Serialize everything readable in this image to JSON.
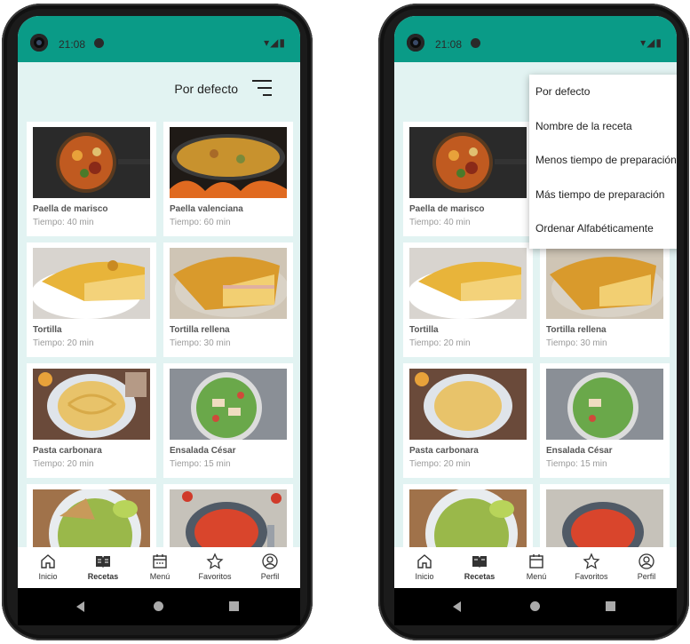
{
  "status": {
    "time": "21:08",
    "right_icons": "▾◢▮"
  },
  "sort": {
    "label": "Por defecto"
  },
  "recipes": [
    {
      "title": "Paella de marisco",
      "time": "Tiempo: 40 min"
    },
    {
      "title": "Paella valenciana",
      "time": "Tiempo: 60 min"
    },
    {
      "title": "Tortilla",
      "time": "Tiempo: 20 min"
    },
    {
      "title": "Tortilla rellena",
      "time": "Tiempo: 30 min"
    },
    {
      "title": "Pasta carbonara",
      "time": "Tiempo: 20 min"
    },
    {
      "title": "Ensalada César",
      "time": "Tiempo: 15 min"
    },
    {
      "title": "",
      "time": ""
    },
    {
      "title": "",
      "time": ""
    }
  ],
  "nav": {
    "items": [
      {
        "label": "Inicio",
        "icon": "home-icon"
      },
      {
        "label": "Recetas",
        "icon": "recipe-book-icon"
      },
      {
        "label": "Menú",
        "icon": "calendar-icon"
      },
      {
        "label": "Favoritos",
        "icon": "star-icon"
      },
      {
        "label": "Perfil",
        "icon": "profile-icon"
      }
    ],
    "active": "Recetas"
  },
  "sort_menu": {
    "options": [
      "Por defecto",
      "Nombre de la receta",
      "Menos tiempo de preparación",
      "Más tiempo de preparación",
      "Ordenar Alfabéticamente"
    ]
  },
  "colors": {
    "status_bar": "#0a9b87",
    "background": "#e2f3f2"
  }
}
